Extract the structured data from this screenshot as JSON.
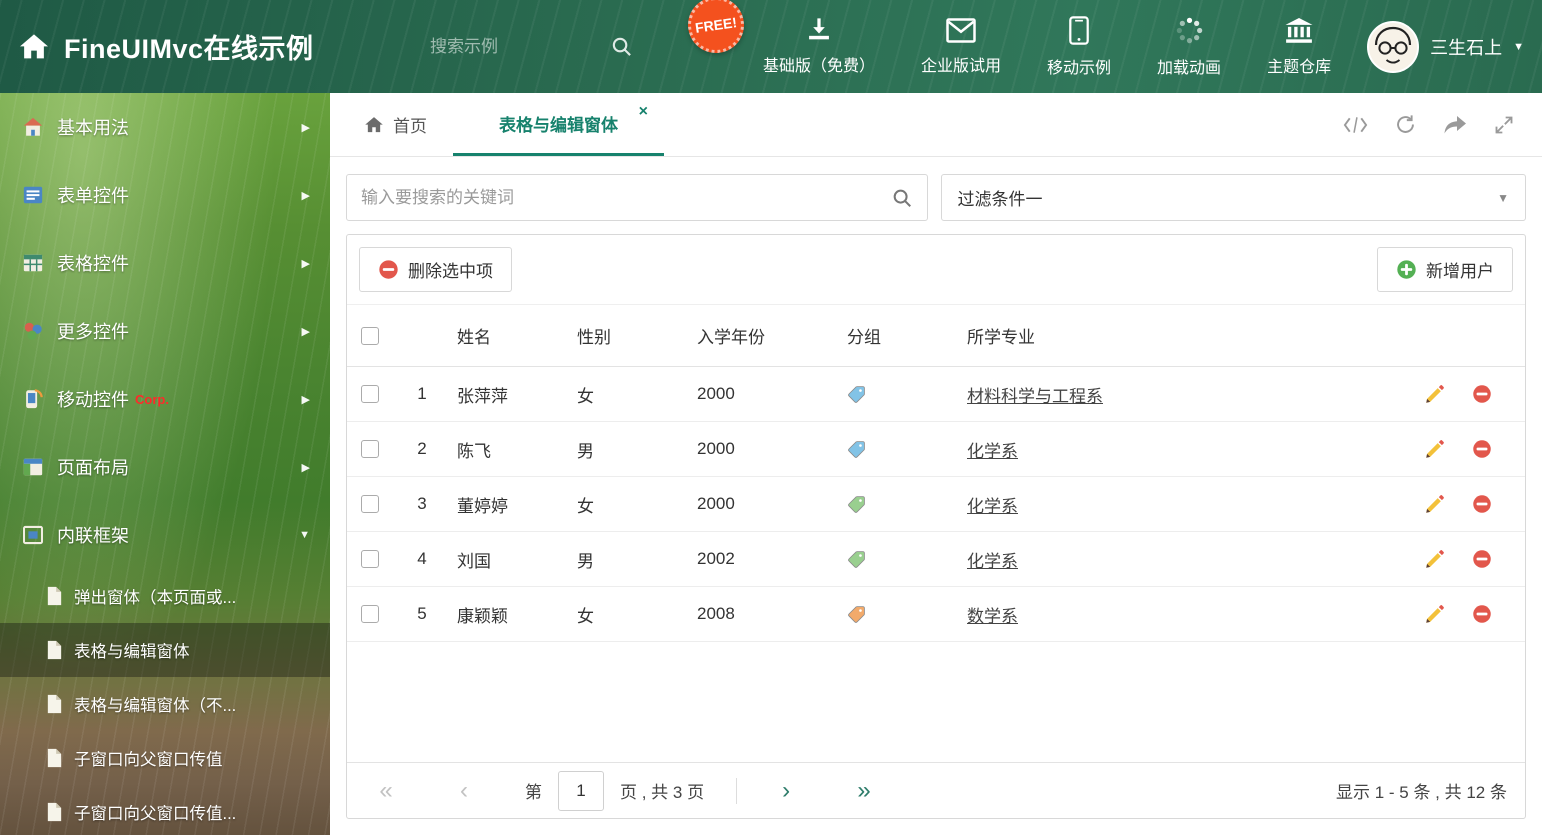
{
  "colors": {
    "accent": "#17826d",
    "danger": "#e2574c",
    "success": "#54b054"
  },
  "header": {
    "title": "FineUIMvc在线示例",
    "search_placeholder": "搜索示例",
    "free_badge": "FREE!",
    "nav": [
      {
        "label": "基础版（免费）",
        "icon": "download-icon"
      },
      {
        "label": "企业版试用",
        "icon": "envelope-icon"
      },
      {
        "label": "移动示例",
        "icon": "mobile-icon"
      },
      {
        "label": "加载动画",
        "icon": "spinner-icon"
      },
      {
        "label": "主题仓库",
        "icon": "bank-icon"
      }
    ],
    "user_name": "三生石上"
  },
  "sidebar": {
    "items": [
      {
        "label": "基本用法",
        "icon": "home-icon"
      },
      {
        "label": "表单控件",
        "icon": "form-icon"
      },
      {
        "label": "表格控件",
        "icon": "grid-icon"
      },
      {
        "label": "更多控件",
        "icon": "shapes-icon"
      },
      {
        "label": "移动控件",
        "icon": "mobile-icon",
        "badge": "Corp."
      },
      {
        "label": "页面布局",
        "icon": "layout-icon"
      },
      {
        "label": "内联框架",
        "icon": "frame-icon"
      }
    ],
    "subitems": [
      {
        "label": "弹出窗体（本页面或..."
      },
      {
        "label": "表格与编辑窗体"
      },
      {
        "label": "表格与编辑窗体（不..."
      },
      {
        "label": "子窗口向父窗口传值"
      },
      {
        "label": "子窗口向父窗口传值..."
      }
    ]
  },
  "tabs": {
    "home": "首页",
    "active": "表格与编辑窗体",
    "close_glyph": "×"
  },
  "filter": {
    "search_placeholder": "输入要搜索的关键词",
    "dropdown_value": "过滤条件一"
  },
  "toolbar": {
    "delete_label": "删除选中项",
    "add_label": "新增用户"
  },
  "table": {
    "columns": [
      "姓名",
      "性别",
      "入学年份",
      "分组",
      "所学专业"
    ],
    "rows": [
      {
        "num": "1",
        "name": "张萍萍",
        "gender": "女",
        "year": "2000",
        "tag_color": "#82c3e6",
        "major": "材料科学与工程系"
      },
      {
        "num": "2",
        "name": "陈飞",
        "gender": "男",
        "year": "2000",
        "tag_color": "#82c3e6",
        "major": "化学系"
      },
      {
        "num": "3",
        "name": "董婷婷",
        "gender": "女",
        "year": "2000",
        "tag_color": "#99cf8f",
        "major": "化学系"
      },
      {
        "num": "4",
        "name": "刘国",
        "gender": "男",
        "year": "2002",
        "tag_color": "#99cf8f",
        "major": "化学系"
      },
      {
        "num": "5",
        "name": "康颖颖",
        "gender": "女",
        "year": "2008",
        "tag_color": "#f2aa6b",
        "major": "数学系"
      }
    ]
  },
  "pagination": {
    "first_glyph": "«",
    "prev_glyph": "‹",
    "page_prefix": "第",
    "page_value": "1",
    "page_suffix": "页 , 共 3 页",
    "next_glyph": "›",
    "last_glyph": "»",
    "summary": "显示 1 - 5 条 , 共 12 条"
  },
  "glyphs": {
    "chevron_right": "▶",
    "chevron_down": "▼",
    "caret_down": "▼"
  }
}
